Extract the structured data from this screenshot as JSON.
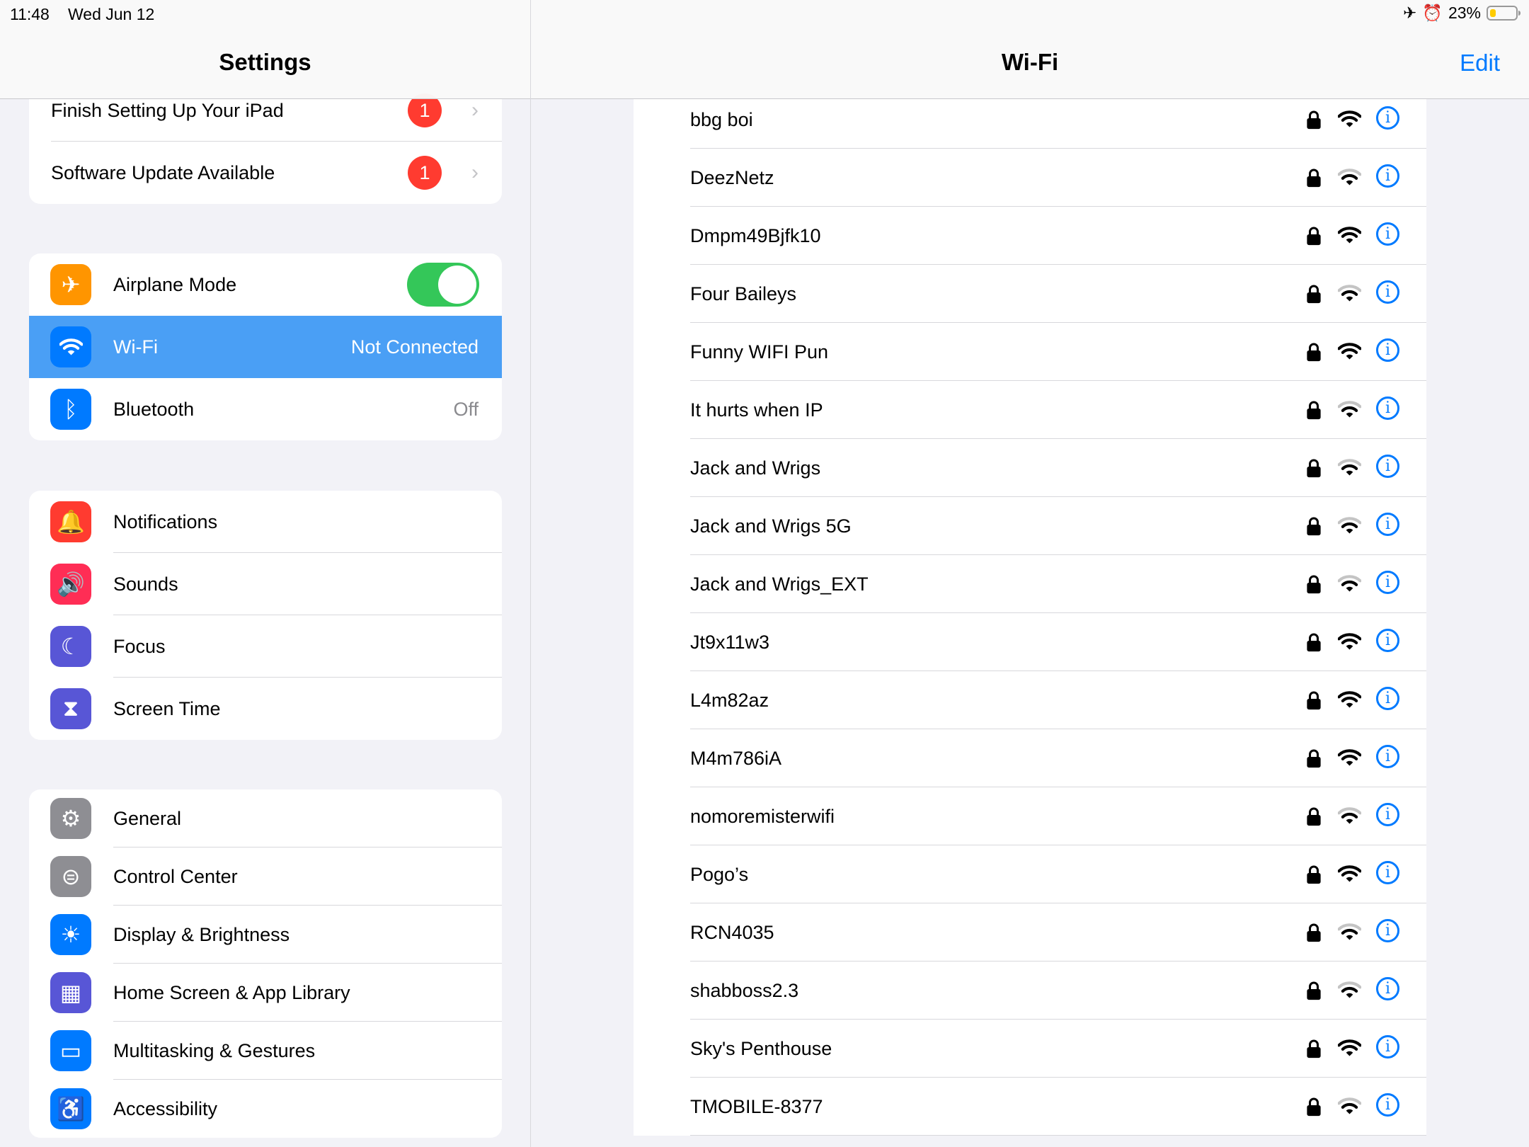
{
  "status_bar": {
    "time": "11:48",
    "date": "Wed Jun 12",
    "battery_percent": "23%",
    "battery_level": 0.23,
    "icons": [
      "airplane-icon",
      "alarm-icon",
      "battery-icon"
    ]
  },
  "sidebar": {
    "title": "Settings",
    "group1": [
      {
        "label": "Finish Setting Up Your iPad",
        "badge": "1"
      },
      {
        "label": "Software Update Available",
        "badge": "1"
      }
    ],
    "group2": [
      {
        "label": "Airplane Mode",
        "icon": "airplane-icon",
        "color": "#ff9500",
        "toggle": true
      },
      {
        "label": "Wi-Fi",
        "icon": "wifi-icon",
        "color": "#007aff",
        "value": "Not Connected",
        "selected": true
      },
      {
        "label": "Bluetooth",
        "icon": "bluetooth-icon",
        "color": "#007aff",
        "value": "Off"
      }
    ],
    "group3": [
      {
        "label": "Notifications",
        "icon": "bell-icon",
        "color": "#ff3b30"
      },
      {
        "label": "Sounds",
        "icon": "speaker-icon",
        "color": "#ff2d55"
      },
      {
        "label": "Focus",
        "icon": "moon-icon",
        "color": "#5856d6"
      },
      {
        "label": "Screen Time",
        "icon": "hourglass-icon",
        "color": "#5856d6"
      }
    ],
    "group4": [
      {
        "label": "General",
        "icon": "gear-icon",
        "color": "#8e8e93"
      },
      {
        "label": "Control Center",
        "icon": "switches-icon",
        "color": "#8e8e93"
      },
      {
        "label": "Display & Brightness",
        "icon": "sun-icon",
        "color": "#007aff"
      },
      {
        "label": "Home Screen & App Library",
        "icon": "app-grid-icon",
        "color": "#5856d6"
      },
      {
        "label": "Multitasking & Gestures",
        "icon": "multitasking-icon",
        "color": "#007aff"
      },
      {
        "label": "Accessibility",
        "icon": "accessibility-icon",
        "color": "#007aff"
      }
    ]
  },
  "detail": {
    "title": "Wi-Fi",
    "edit_label": "Edit",
    "networks": [
      {
        "name": "bbg boi",
        "secured": true,
        "signal": 3
      },
      {
        "name": "DeezNetz",
        "secured": true,
        "signal": 2
      },
      {
        "name": "Dmpm49Bjfk10",
        "secured": true,
        "signal": 3
      },
      {
        "name": "Four Baileys",
        "secured": true,
        "signal": 2
      },
      {
        "name": "Funny WIFI Pun",
        "secured": true,
        "signal": 3
      },
      {
        "name": "It hurts when IP",
        "secured": true,
        "signal": 2
      },
      {
        "name": "Jack and Wrigs",
        "secured": true,
        "signal": 2
      },
      {
        "name": "Jack and Wrigs 5G",
        "secured": true,
        "signal": 2
      },
      {
        "name": "Jack and Wrigs_EXT",
        "secured": true,
        "signal": 2
      },
      {
        "name": "Jt9x11w3",
        "secured": true,
        "signal": 3
      },
      {
        "name": "L4m82az",
        "secured": true,
        "signal": 3
      },
      {
        "name": "M4m786iA",
        "secured": true,
        "signal": 3
      },
      {
        "name": "nomoremisterwifi",
        "secured": true,
        "signal": 2
      },
      {
        "name": "Pogo’s",
        "secured": true,
        "signal": 3
      },
      {
        "name": "RCN4035",
        "secured": true,
        "signal": 2
      },
      {
        "name": "shabboss2.3",
        "secured": true,
        "signal": 2
      },
      {
        "name": "Sky's Penthouse",
        "secured": true,
        "signal": 3
      },
      {
        "name": "TMOBILE-8377",
        "secured": true,
        "signal": 2
      }
    ],
    "accent": "#007aff"
  }
}
